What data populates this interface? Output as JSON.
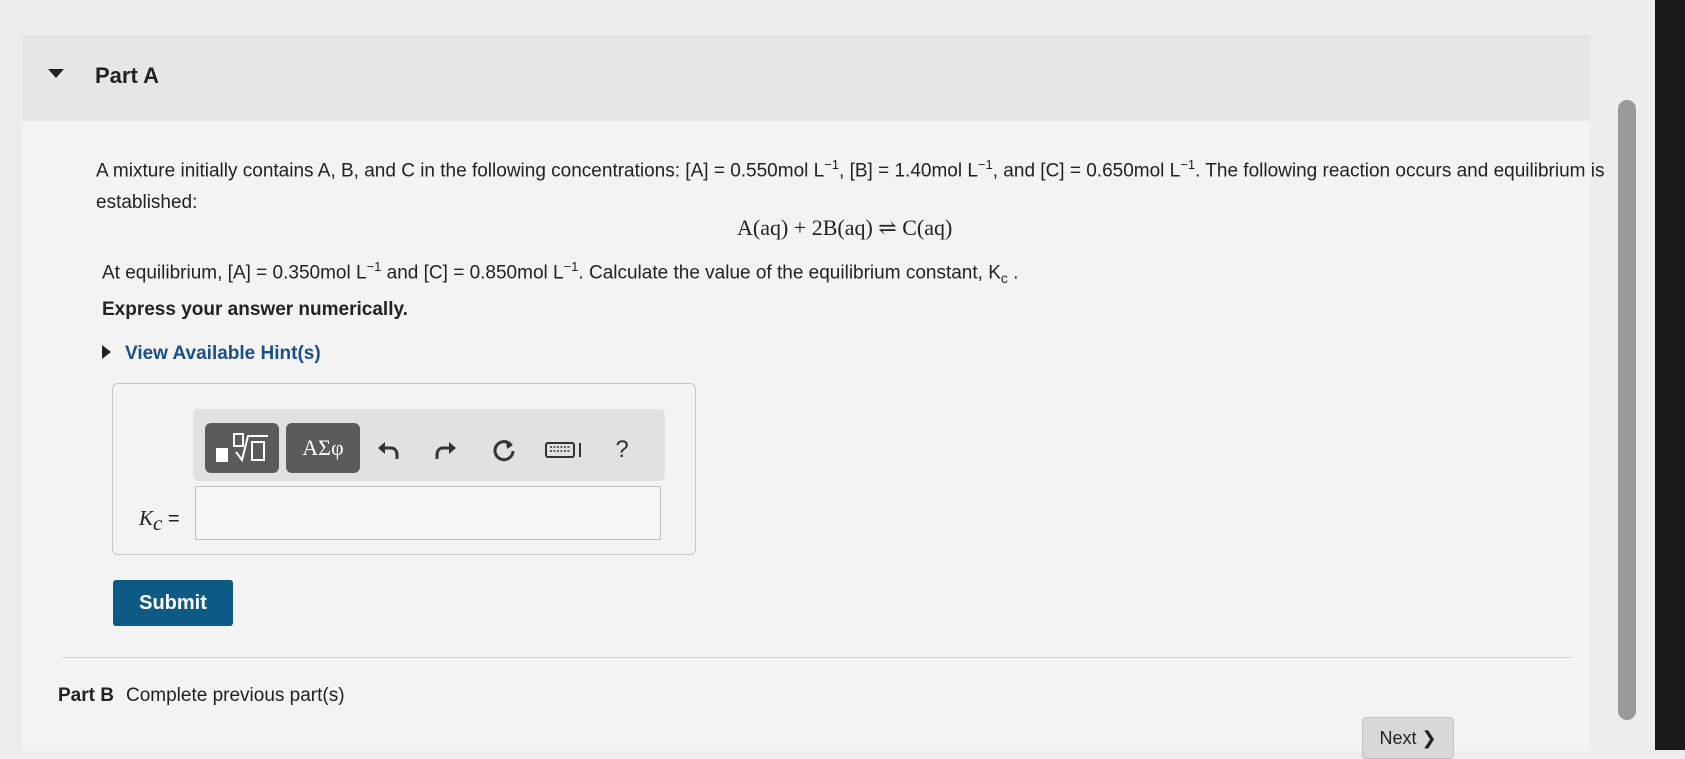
{
  "part_a": {
    "title": "Part A"
  },
  "problem": {
    "intro": "A mixture initially contains A, B, and C in the following concentrations: [A] = 0.550mol L",
    "sup1": "−1",
    "mid1": ", [B] = 1.40mol L",
    "sup2": "−1",
    "mid2": ", and [C] = 0.650mol L",
    "sup3": "−1",
    "tail": ". The following reaction occurs and equilibrium is established:"
  },
  "reaction": "A(aq) + 2B(aq) ⇌ C(aq)",
  "equilibrium": {
    "start": "At equilibrium, [A] = 0.350mol L",
    "sup1": "−1",
    "mid": " and [C] = 0.850mol L",
    "sup2": "−1",
    "end": ". Calculate the value of the equilibrium constant, K",
    "sub": "c",
    "dot": " ."
  },
  "instruction": "Express your answer numerically.",
  "hint_label": "View Available Hint(s)",
  "toolbar": {
    "greek_label": "ΑΣφ",
    "help_label": "?"
  },
  "answer": {
    "label_main": "K",
    "label_sub": "c",
    "label_eq": " =",
    "value": ""
  },
  "submit_label": "Submit",
  "part_b": {
    "label": "Part B",
    "status": "Complete previous part(s)"
  },
  "next_label": "Next ❯"
}
